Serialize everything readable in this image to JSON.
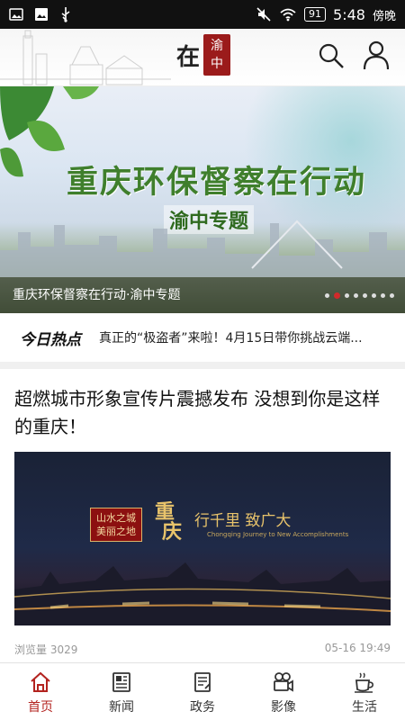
{
  "status_bar": {
    "battery": "91",
    "time": "5:48",
    "period": "傍晚"
  },
  "header": {
    "logo_char": "在",
    "logo_seal_top": "渝",
    "logo_seal_bottom": "中"
  },
  "banner": {
    "title": "重庆环保督察在行动",
    "subtitle": "渝中专题",
    "caption": "重庆环保督察在行动·渝中专题",
    "slide_count": 8,
    "active_slide": 1
  },
  "hot": {
    "label": "今日热点",
    "text": "真正的“极盗者”来啦！4月15日带你挑战云端..."
  },
  "article": {
    "title": "超燃城市形象宣传片震撼发布 没想到你是这样的重庆！",
    "image": {
      "stamp_line1": "山水之城",
      "stamp_line2": "美丽之地",
      "city_name_1": "重",
      "city_name_2": "庆",
      "slogan": "行千里 致广大",
      "english": "Chongqing Journey to New Accomplishments"
    },
    "views": "浏览量 3029",
    "date": "05-16 19:49"
  },
  "tabs": [
    {
      "label": "首页",
      "icon": "home-icon",
      "active": true
    },
    {
      "label": "新闻",
      "icon": "newspaper-icon",
      "active": false
    },
    {
      "label": "政务",
      "icon": "document-icon",
      "active": false
    },
    {
      "label": "影像",
      "icon": "camera-icon",
      "active": false
    },
    {
      "label": "生活",
      "icon": "coffee-icon",
      "active": false
    }
  ],
  "colors": {
    "accent": "#b3231f",
    "hot_dot": "#d12a2a"
  }
}
